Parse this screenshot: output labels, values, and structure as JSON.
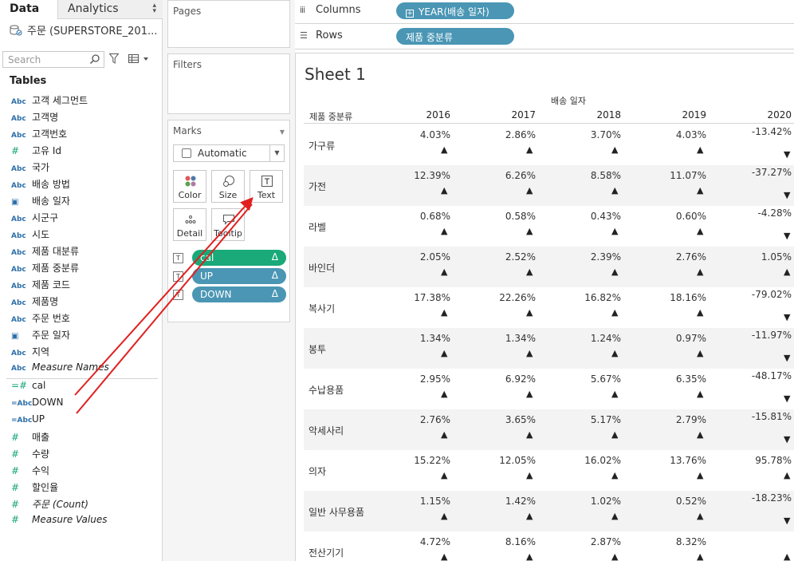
{
  "left_pane": {
    "tab_data": "Data",
    "tab_analytics": "Analytics",
    "datasource": "주문 (SUPERSTORE_201...",
    "search_placeholder": "Search",
    "tables_heading": "Tables",
    "fields": [
      {
        "type": "Abc",
        "name": "고객 세그먼트"
      },
      {
        "type": "Abc",
        "name": "고객명"
      },
      {
        "type": "Abc",
        "name": "고객번호"
      },
      {
        "type": "#",
        "name": "고유 Id"
      },
      {
        "type": "Abc",
        "name": "국가"
      },
      {
        "type": "Abc",
        "name": "배송 방법"
      },
      {
        "type": "date",
        "name": "배송 일자"
      },
      {
        "type": "Abc",
        "name": "시군구"
      },
      {
        "type": "Abc",
        "name": "시도"
      },
      {
        "type": "Abc",
        "name": "제품 대분류"
      },
      {
        "type": "Abc",
        "name": "제품 중분류"
      },
      {
        "type": "Abc",
        "name": "제품 코드"
      },
      {
        "type": "Abc",
        "name": "제품명"
      },
      {
        "type": "Abc",
        "name": "주문 번호"
      },
      {
        "type": "date",
        "name": "주문 일자"
      },
      {
        "type": "Abc",
        "name": "지역"
      },
      {
        "type": "Abc",
        "name": "Measure Names"
      },
      {
        "type": "=#",
        "name": "cal"
      },
      {
        "type": "=Abc",
        "name": "DOWN"
      },
      {
        "type": "=Abc",
        "name": "UP"
      },
      {
        "type": "#",
        "name": "매출"
      },
      {
        "type": "#",
        "name": "수량"
      },
      {
        "type": "#",
        "name": "수익"
      },
      {
        "type": "#",
        "name": "할인율"
      },
      {
        "type": "#",
        "name": "주문 (Count)"
      },
      {
        "type": "#",
        "name": "Measure Values"
      }
    ]
  },
  "cards": {
    "pages": "Pages",
    "filters": "Filters",
    "marks": "Marks",
    "mark_type": "Automatic",
    "buttons": {
      "color": "Color",
      "size": "Size",
      "text": "Text",
      "detail": "Detail",
      "tooltip": "Tooltip"
    },
    "pills": [
      {
        "label": "cal",
        "color": "#1aa979"
      },
      {
        "label": "UP",
        "color": "#4a96b4"
      },
      {
        "label": "DOWN",
        "color": "#4a96b4"
      }
    ],
    "delta": "Δ"
  },
  "shelves": {
    "columns_label": "Columns",
    "columns_pill": "YEAR(배송 일자)",
    "rows_label": "Rows",
    "rows_pill": "제품 중분류"
  },
  "view": {
    "sheet_title": "Sheet 1",
    "column_group": "배송 일자",
    "row_dimension": "제품 중분류",
    "years": [
      "2016",
      "2017",
      "2018",
      "2019",
      "2020"
    ],
    "rows": [
      {
        "name": "가구류",
        "values": [
          "4.03%",
          "2.86%",
          "3.70%",
          "4.03%",
          "-13.42%"
        ]
      },
      {
        "name": "가전",
        "values": [
          "12.39%",
          "6.26%",
          "8.58%",
          "11.07%",
          "-37.27%"
        ]
      },
      {
        "name": "라벨",
        "values": [
          "0.68%",
          "0.58%",
          "0.43%",
          "0.60%",
          "-4.28%"
        ]
      },
      {
        "name": "바인더",
        "values": [
          "2.05%",
          "2.52%",
          "2.39%",
          "2.76%",
          "1.05%"
        ]
      },
      {
        "name": "복사기",
        "values": [
          "17.38%",
          "22.26%",
          "16.82%",
          "18.16%",
          "-79.02%"
        ]
      },
      {
        "name": "봉투",
        "values": [
          "1.34%",
          "1.34%",
          "1.24%",
          "0.97%",
          "-11.97%"
        ]
      },
      {
        "name": "수납용품",
        "values": [
          "2.95%",
          "6.92%",
          "5.67%",
          "6.35%",
          "-48.17%"
        ]
      },
      {
        "name": "악세사리",
        "values": [
          "2.76%",
          "3.65%",
          "5.17%",
          "2.79%",
          "-15.81%"
        ]
      },
      {
        "name": "의자",
        "values": [
          "15.22%",
          "12.05%",
          "16.02%",
          "13.76%",
          "95.78%"
        ]
      },
      {
        "name": "일반 사무용품",
        "values": [
          "1.15%",
          "1.42%",
          "1.02%",
          "0.52%",
          "-18.23%"
        ]
      },
      {
        "name": "전산기기",
        "values": [
          "4.72%",
          "8.16%",
          "2.87%",
          "8.32%",
          ""
        ]
      }
    ],
    "up_glyph": "▲",
    "down_glyph": "▼"
  },
  "colors": {
    "pill_green": "#1aa979",
    "pill_blue": "#4a96b4",
    "annotation_red": "#e02020"
  }
}
